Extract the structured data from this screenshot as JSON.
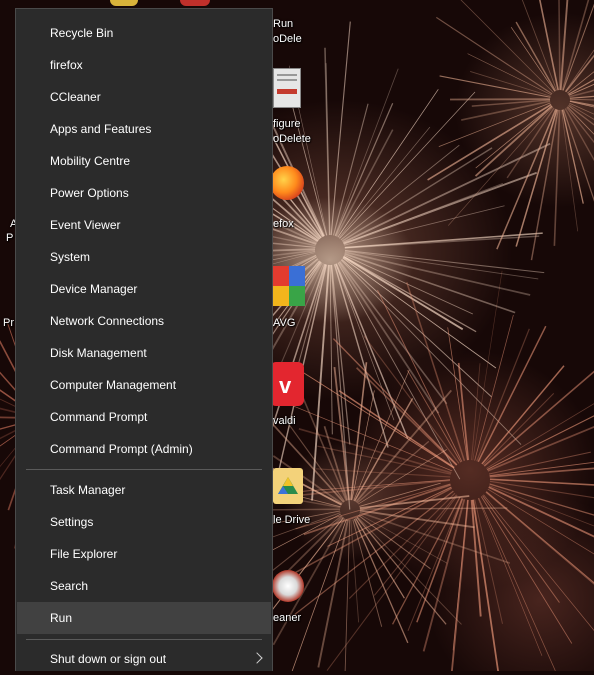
{
  "desktop": {
    "icons": [
      {
        "name": "run-shortcut",
        "label_lines": [
          "Run",
          "oDele"
        ]
      },
      {
        "name": "configure-shortcut",
        "label_lines": [
          "figure",
          "oDelete"
        ]
      },
      {
        "name": "firefox-shortcut",
        "label_lines": [
          "efox"
        ]
      },
      {
        "name": "avg-shortcut",
        "label_lines": [
          "AVG"
        ]
      },
      {
        "name": "vivaldi-shortcut",
        "label_lines": [
          "valdi"
        ]
      },
      {
        "name": "drive-shortcut",
        "label_lines": [
          "le Drive"
        ]
      },
      {
        "name": "ccleaner-shortcut",
        "label_lines": [
          "eaner"
        ]
      }
    ],
    "left_edge_labels": [
      "A",
      "P",
      "Pr"
    ]
  },
  "menu": {
    "groups": [
      [
        "Recycle Bin",
        "firefox",
        "CCleaner",
        "Apps and Features",
        "Mobility Centre",
        "Power Options",
        "Event Viewer",
        "System",
        "Device Manager",
        "Network Connections",
        "Disk Management",
        "Computer Management",
        "Command Prompt",
        "Command Prompt (Admin)"
      ],
      [
        "Task Manager",
        "Settings",
        "File Explorer",
        "Search",
        "Run"
      ],
      [
        "Shut down or sign out"
      ]
    ],
    "active_item": "Run",
    "colors": {
      "background": "#2b2b2b",
      "hover": "#414141",
      "text": "#ffffff"
    }
  }
}
